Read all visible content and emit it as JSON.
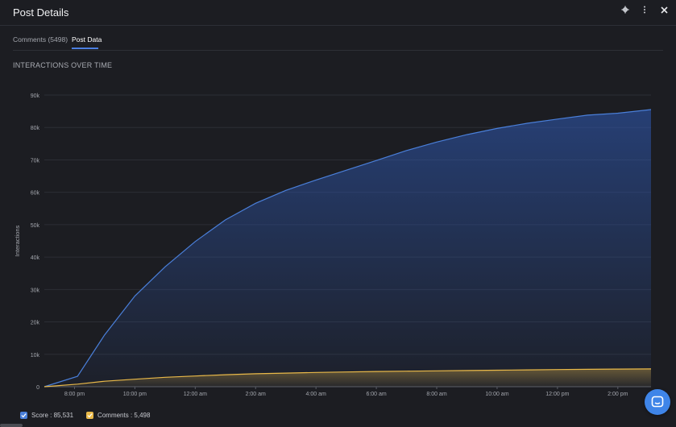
{
  "window": {
    "title": "Post Details"
  },
  "tabs": [
    {
      "label": "Comments (5498)"
    },
    {
      "label": "Post Data"
    }
  ],
  "section": {
    "title": "INTERACTIONS OVER TIME"
  },
  "legend": [
    {
      "label": "Score : 85,531",
      "color": "#4a7fd9"
    },
    {
      "label": "Comments : 5,498",
      "color": "#e9b949"
    }
  ],
  "icons": [
    "gear-icon",
    "more-icon",
    "close-icon",
    "chat-icon"
  ],
  "chart_data": {
    "type": "area",
    "ylabel": "Interactions",
    "ylim": [
      0,
      90000
    ],
    "yticks": [
      "0",
      "10k",
      "20k",
      "30k",
      "40k",
      "50k",
      "60k",
      "70k",
      "80k",
      "90k"
    ],
    "xlim": [
      -1.0,
      19.1
    ],
    "xticks": [
      {
        "x": 0,
        "label": "8:00 pm"
      },
      {
        "x": 2,
        "label": "10:00 pm"
      },
      {
        "x": 4,
        "label": "12:00 am"
      },
      {
        "x": 6,
        "label": "2:00 am"
      },
      {
        "x": 8,
        "label": "4:00 am"
      },
      {
        "x": 10,
        "label": "6:00 am"
      },
      {
        "x": 12,
        "label": "8:00 am"
      },
      {
        "x": 14,
        "label": "10:00 am"
      },
      {
        "x": 16,
        "label": "12:00 pm"
      },
      {
        "x": 18,
        "label": "2:00 pm"
      }
    ],
    "series": [
      {
        "name": "Score",
        "color": "#4a7fd9",
        "x": [
          -1.0,
          0.1,
          1.0,
          2.0,
          3.0,
          4.0,
          5.0,
          6.0,
          7.0,
          8.0,
          9.0,
          10.0,
          11.0,
          12.0,
          13.0,
          14.0,
          15.0,
          16.0,
          17.0,
          18.0,
          19.1
        ],
        "values": [
          0,
          3200,
          16000,
          28000,
          37000,
          44800,
          51500,
          56600,
          60600,
          63800,
          66800,
          69800,
          72900,
          75500,
          77800,
          79700,
          81300,
          82600,
          83800,
          84400,
          85531
        ]
      },
      {
        "name": "Comments",
        "color": "#e9b949",
        "x": [
          -1.0,
          0.1,
          1.0,
          2.0,
          3.0,
          4.0,
          5.0,
          6.0,
          7.0,
          8.0,
          9.0,
          10.0,
          11.0,
          12.0,
          13.0,
          14.0,
          15.0,
          16.0,
          17.0,
          18.0,
          19.1
        ],
        "values": [
          0,
          800,
          1700,
          2300,
          2900,
          3300,
          3700,
          4000,
          4200,
          4400,
          4550,
          4700,
          4800,
          4900,
          5000,
          5100,
          5200,
          5300,
          5380,
          5440,
          5498
        ]
      }
    ]
  }
}
